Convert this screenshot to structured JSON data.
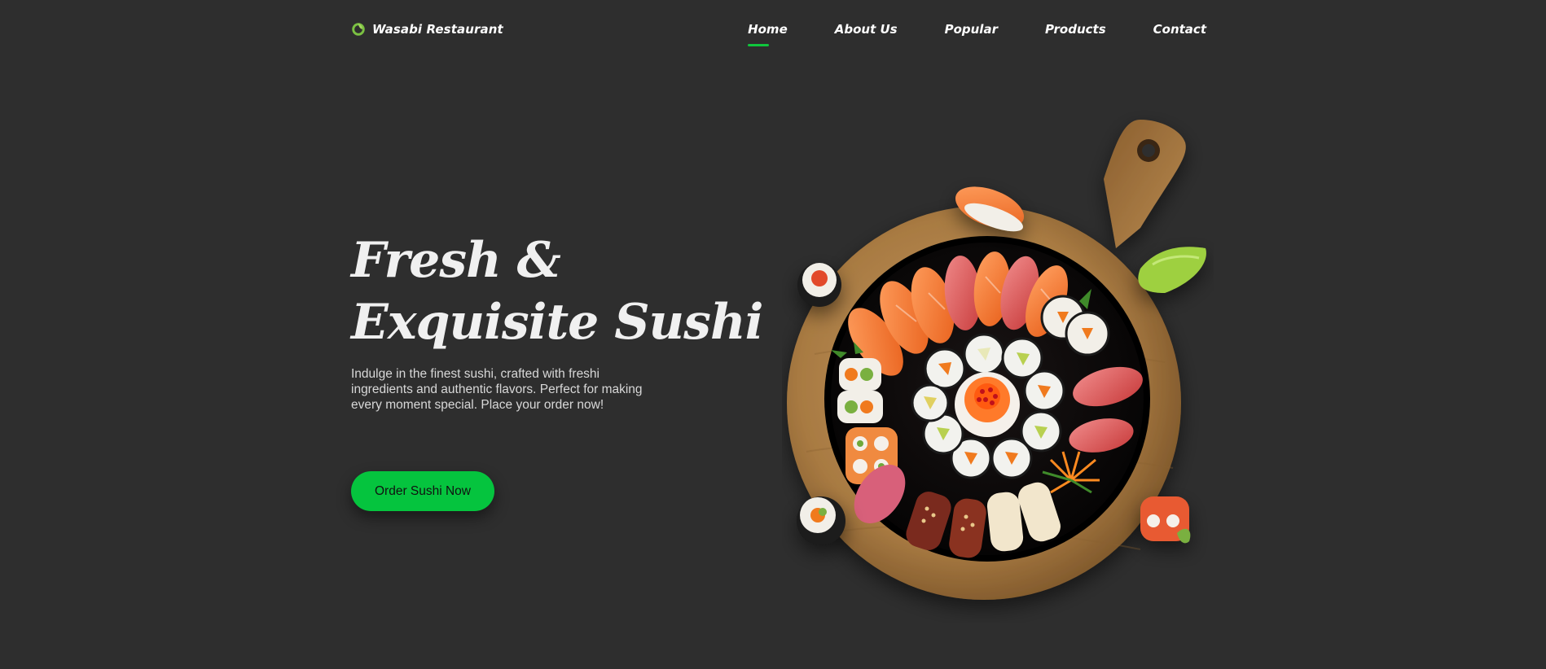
{
  "brand": {
    "name": "Wasabi Restaurant",
    "icon": "leaf-circle-icon",
    "accent_color": "#0fc63c"
  },
  "nav": {
    "items": [
      {
        "label": "Home",
        "active": true
      },
      {
        "label": "About Us",
        "active": false
      },
      {
        "label": "Popular",
        "active": false
      },
      {
        "label": "Products",
        "active": false
      },
      {
        "label": "Contact",
        "active": false
      }
    ]
  },
  "hero": {
    "title_line1": "Fresh &",
    "title_line2": "Exquisite Sushi",
    "description": "Indulge in the finest sushi, crafted with freshi ingredients and authentic flavors. Perfect for making every moment special. Place your order now!",
    "cta_label": "Order Sushi Now",
    "cta_color": "#05c43e",
    "image": "sushi-platter-on-wooden-board"
  },
  "colors": {
    "background": "#2e2e2e",
    "text": "#ffffff"
  }
}
